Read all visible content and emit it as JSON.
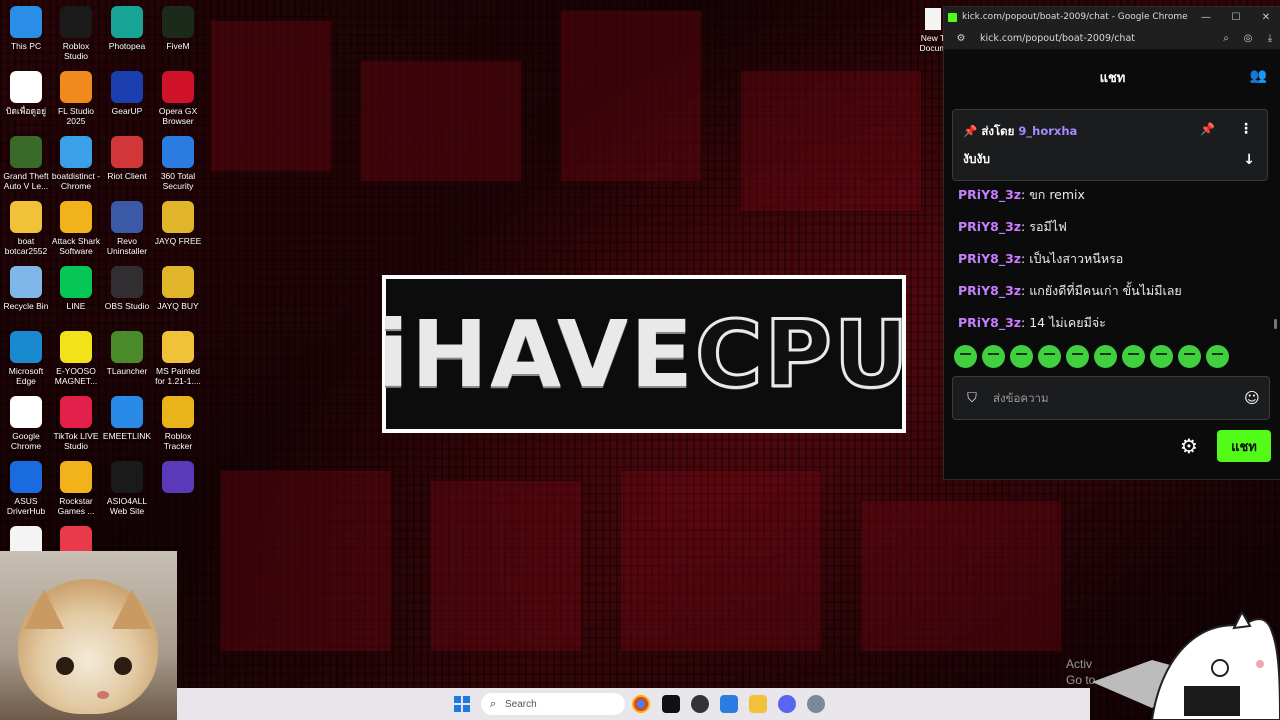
{
  "desktop": {
    "icons": [
      {
        "label": "This PC",
        "icon": "monitor-icon",
        "color": "#2a8ee6"
      },
      {
        "label": "Roblox Studio",
        "icon": "roblox-studio-icon",
        "color": "#1a1a1a"
      },
      {
        "label": "Photopea",
        "icon": "photopea-icon",
        "color": "#18a497"
      },
      {
        "label": "FiveM",
        "icon": "fivem-icon",
        "color": "#1b2a1b"
      },
      {
        "label": "บิดเพื่อดูอยู่",
        "icon": "chrome-icon",
        "color": "#ffffff"
      },
      {
        "label": "FL Studio 2025",
        "icon": "fl-studio-icon",
        "color": "#f08a1c"
      },
      {
        "label": "GearUP",
        "icon": "gearup-icon",
        "color": "#1c3fb0"
      },
      {
        "label": "Opera GX Browser",
        "icon": "opera-gx-icon",
        "color": "#d1122b"
      },
      {
        "label": "Grand Theft Auto V Le...",
        "icon": "gta-icon",
        "color": "#3a6a2a"
      },
      {
        "label": "boatdistinct - Chrome",
        "icon": "chrome-profile-icon",
        "color": "#3aa0e8"
      },
      {
        "label": "Riot Client",
        "icon": "riot-icon",
        "color": "#d13639"
      },
      {
        "label": "360 Total Security",
        "icon": "360-security-icon",
        "color": "#2a7ce0"
      },
      {
        "label": "boat botcar2552",
        "icon": "folder-icon",
        "color": "#f0c23a"
      },
      {
        "label": "Attack Shark Software",
        "icon": "attack-shark-icon",
        "color": "#f2b21a"
      },
      {
        "label": "Revo Uninstaller",
        "icon": "revo-icon",
        "color": "#3a5aa8"
      },
      {
        "label": "JAYQ FREE",
        "icon": "jayq-icon",
        "color": "#e0b52a"
      },
      {
        "label": "Recycle Bin",
        "icon": "recycle-bin-icon",
        "color": "#7fb8e8"
      },
      {
        "label": "LINE",
        "icon": "line-icon",
        "color": "#06c755"
      },
      {
        "label": "OBS Studio",
        "icon": "obs-icon",
        "color": "#302e31"
      },
      {
        "label": "JAYQ BUY",
        "icon": "jayq-icon",
        "color": "#e0b52a"
      },
      {
        "label": "Microsoft Edge",
        "icon": "edge-icon",
        "color": "#1a8ad0"
      },
      {
        "label": "E-YOOSO MAGNET...",
        "icon": "eyooso-icon",
        "color": "#f2e21a"
      },
      {
        "label": "TLauncher",
        "icon": "tlauncher-icon",
        "color": "#4a8a2a"
      },
      {
        "label": "MS Painted for 1.21-1....",
        "icon": "folder-icon",
        "color": "#f0c23a"
      },
      {
        "label": "Google Chrome",
        "icon": "chrome-icon",
        "color": "#ffffff"
      },
      {
        "label": "TikTok LIVE Studio",
        "icon": "tiktok-icon",
        "color": "#e2204a"
      },
      {
        "label": "EMEETLINK",
        "icon": "emeetlink-icon",
        "color": "#2a8ae8"
      },
      {
        "label": "Roblox Tracker",
        "icon": "roblox-tracker-icon",
        "color": "#e8b41a"
      },
      {
        "label": "ASUS DriverHub",
        "icon": "asus-driverhub-icon",
        "color": "#1a6ae0"
      },
      {
        "label": "Rockstar Games ...",
        "icon": "rockstar-icon",
        "color": "#f2b21a"
      },
      {
        "label": "ASIO4ALL Web Site",
        "icon": "asio4all-icon",
        "color": "#1a1a1a"
      },
      {
        "label": "",
        "icon": "app-icon",
        "color": "#5a3ab8"
      },
      {
        "label": "",
        "icon": "document-icon",
        "color": "#f4f4f4"
      },
      {
        "label": "",
        "icon": "app-icon",
        "color": "#e83a4a"
      }
    ],
    "new_doc_label": "New T Docum",
    "wallpaper_logo": {
      "text": "iHAVE",
      "text_cpu": "CPU"
    },
    "activate_text_1": "Activ",
    "activate_text_2": "Go to"
  },
  "chrome": {
    "title": "kick.com/popout/boat-2009/chat - Google Chrome",
    "url": "kick.com/popout/boat-2009/chat",
    "window_buttons": {
      "minimize": "—",
      "maximize": "☐",
      "close": "✕"
    }
  },
  "chat": {
    "header_title": "แชท",
    "pinned": {
      "prefix": "ส่งโดย",
      "user": "9_horxha",
      "message": "งับงับ"
    },
    "messages": [
      {
        "user": "PRiY8_3z",
        "text": ": ขก remix"
      },
      {
        "user": "PRiY8_3z",
        "text": ": รอมีไฟ"
      },
      {
        "user": "PRiY8_3z",
        "text": ": เป็นไงสาวหนีหรอ"
      },
      {
        "user": "PRiY8_3z",
        "text": ": แกยังดีที่มีคนเก่า ขั้นไม่มีเลย"
      },
      {
        "user": "PRiY8_3z",
        "text": ": 14 ไม่เคยมีจ่ะ"
      }
    ],
    "emote_count": 10,
    "input_placeholder": "ส่งข้อความ",
    "send_label": "แชท",
    "accent_color": "#53fc18",
    "username_color": "#c77dff"
  },
  "taskbar": {
    "search_placeholder": "Search"
  }
}
